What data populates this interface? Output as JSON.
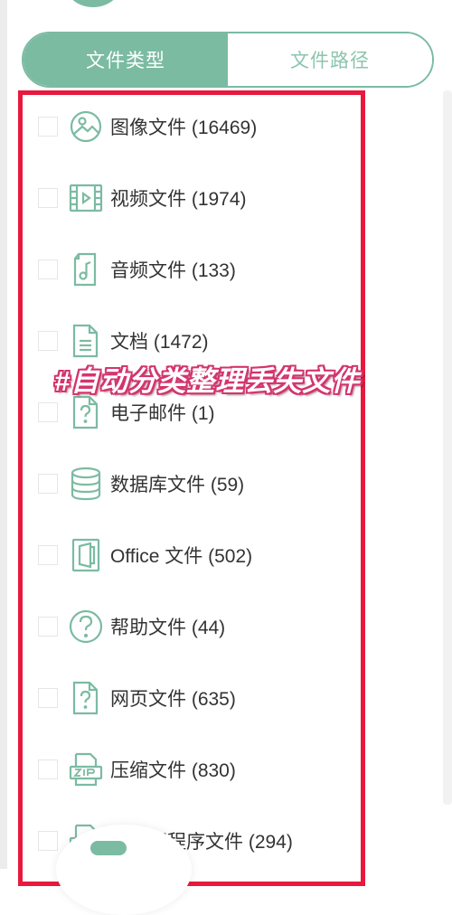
{
  "tabs": [
    {
      "label": "文件类型",
      "active": true
    },
    {
      "label": "文件路径",
      "active": false
    }
  ],
  "file_types": [
    {
      "label": "图像文件 (16469)",
      "icon": "image-icon"
    },
    {
      "label": "视频文件 (1974)",
      "icon": "video-icon"
    },
    {
      "label": "音频文件 (133)",
      "icon": "audio-icon"
    },
    {
      "label": "文档 (1472)",
      "icon": "document-icon"
    },
    {
      "label": "电子邮件 (1)",
      "icon": "email-unknown-icon"
    },
    {
      "label": "数据库文件 (59)",
      "icon": "database-icon"
    },
    {
      "label": "Office 文件 (502)",
      "icon": "office-icon"
    },
    {
      "label": "帮助文件 (44)",
      "icon": "help-icon"
    },
    {
      "label": "网页文件 (635)",
      "icon": "webpage-unknown-icon"
    },
    {
      "label": "压缩文件 (830)",
      "icon": "zip-icon"
    },
    {
      "label": "可执行程序文件 (294)",
      "icon": "executable-icon"
    }
  ],
  "overlay_caption": "#自动分类整理丢失文件",
  "colors": {
    "accent": "#7bbba2",
    "highlight_frame": "#e8193c",
    "caption_outline": "#d4346c"
  }
}
